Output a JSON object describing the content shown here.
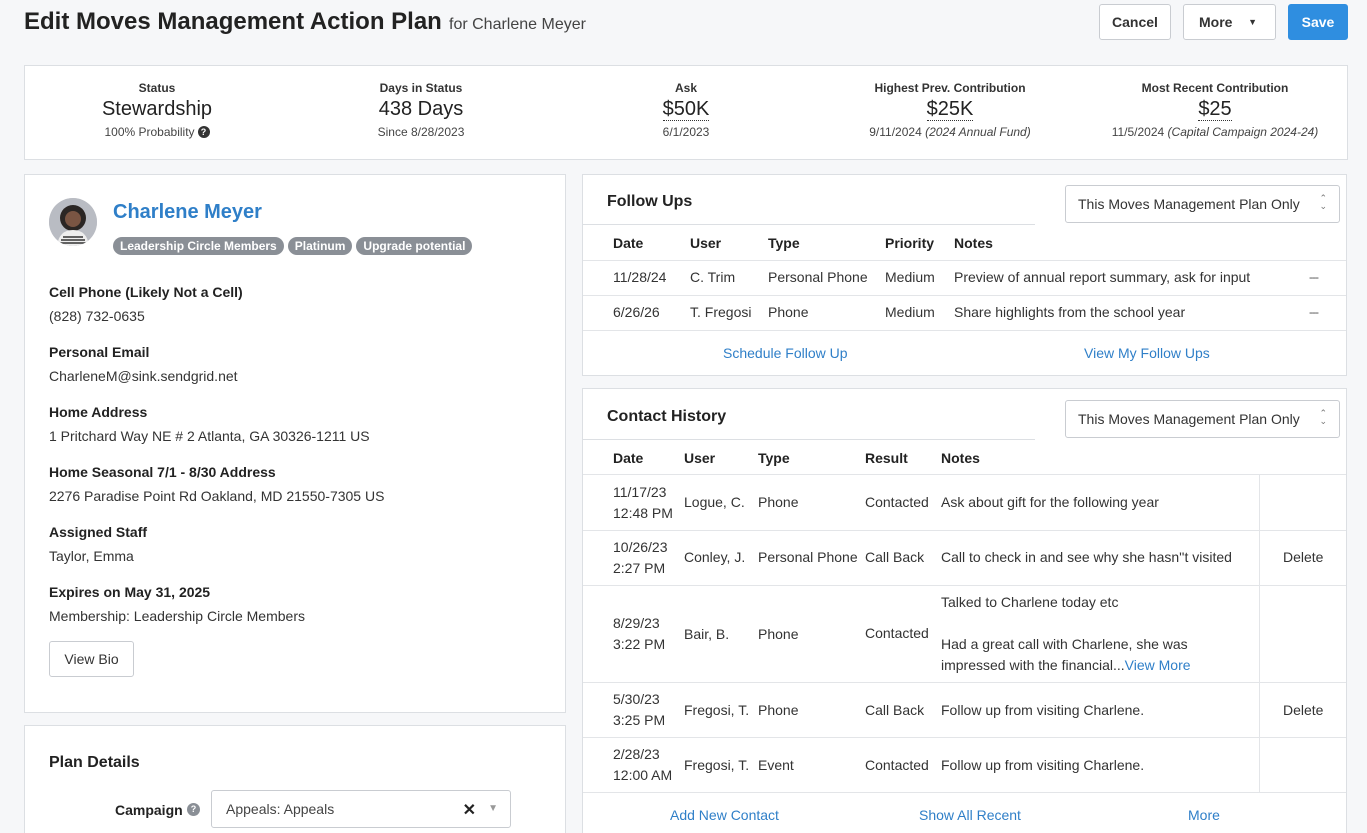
{
  "header": {
    "title": "Edit Moves Management Action Plan",
    "subtitle": "for Charlene Meyer",
    "cancel_label": "Cancel",
    "more_label": "More",
    "more_caret": "▼",
    "save_label": "Save"
  },
  "stats": [
    {
      "label": "Status",
      "value": "Stewardship",
      "sub": "100% Probability"
    },
    {
      "label": "Days in Status",
      "value": "438 Days",
      "sub": "Since 8/28/2023"
    },
    {
      "label": "Ask",
      "value": "$50K",
      "sub": "6/1/2023"
    },
    {
      "label": "Highest Prev. Contribution",
      "value": "$25K",
      "sub_date": "9/11/2024",
      "sub_note": "(2024 Annual Fund)"
    },
    {
      "label": "Most Recent Contribution",
      "value": "$25",
      "sub_date": "11/5/2024",
      "sub_note": "(Capital Campaign 2024-24)"
    }
  ],
  "profile": {
    "name": "Charlene Meyer",
    "badges": [
      "Leadership Circle Members",
      "Platinum",
      "Upgrade potential"
    ],
    "fields": [
      {
        "label": "Cell Phone (Likely Not a Cell)",
        "value": "(828) 732-0635"
      },
      {
        "label": "Personal Email",
        "value": "CharleneM@sink.sendgrid.net"
      },
      {
        "label": "Home Address",
        "value": "1 Pritchard Way NE # 2 Atlanta, GA 30326-1211 US"
      },
      {
        "label": "Home Seasonal 7/1 - 8/30 Address",
        "value": "2276 Paradise Point Rd Oakland, MD 21550-7305 US"
      },
      {
        "label": "Assigned Staff",
        "value": "Taylor, Emma"
      },
      {
        "label": "Expires on May 31, 2025",
        "value": "Membership: Leadership Circle Members"
      }
    ],
    "view_bio_label": "View Bio"
  },
  "plan_details": {
    "title": "Plan Details",
    "campaign_label": "Campaign",
    "campaign_value": "Appeals: Appeals"
  },
  "followups": {
    "title": "Follow Ups",
    "scope": "This Moves Management Plan Only",
    "columns": [
      "Date",
      "User",
      "Type",
      "Priority",
      "Notes"
    ],
    "rows": [
      {
        "date": "11/28/24",
        "user": "C. Trim",
        "type": "Personal Phone",
        "priority": "Medium",
        "notes": "Preview of annual report summary, ask for input"
      },
      {
        "date": "6/26/26",
        "user": "T. Fregosi",
        "type": "Phone",
        "priority": "Medium",
        "notes": "Share highlights from the school year"
      }
    ],
    "row_menu": "---",
    "schedule_label": "Schedule Follow Up",
    "view_mine_label": "View My Follow Ups"
  },
  "history": {
    "title": "Contact History",
    "scope": "This Moves Management Plan Only",
    "columns": [
      "Date",
      "User",
      "Type",
      "Result",
      "Notes"
    ],
    "rows": [
      {
        "date": "11/17/23",
        "time": "12:48 PM",
        "user": "Logue, C.",
        "type": "Phone",
        "result": "Contacted",
        "notes": "Ask about gift for the following year",
        "action": ""
      },
      {
        "date": "10/26/23",
        "time": "2:27 PM",
        "user": "Conley, J.",
        "type": "Personal Phone",
        "result": "Call Back",
        "notes": "Call to check in and see why she hasn''t visited",
        "action": "Delete"
      },
      {
        "date": "8/29/23",
        "time": "3:22 PM",
        "user": "Bair, B.",
        "type": "Phone",
        "result": "Contacted",
        "notes_line1": "Talked to Charlene today etc",
        "notes_line2": "Had a great call with Charlene, she was",
        "notes_line3": "impressed with the financial...",
        "view_more": "View More",
        "action": ""
      },
      {
        "date": "5/30/23",
        "time": "3:25 PM",
        "user": "Fregosi, T.",
        "type": "Phone",
        "result": "Call Back",
        "notes": "Follow up from visiting Charlene.",
        "action": "Delete"
      },
      {
        "date": "2/28/23",
        "time": "12:00 AM",
        "user": "Fregosi, T.",
        "type": "Event",
        "result": "Contacted",
        "notes": "Follow up from visiting Charlene.",
        "action": ""
      }
    ],
    "add_label": "Add New Contact",
    "show_all_label": "Show All Recent",
    "more_label": "More"
  }
}
